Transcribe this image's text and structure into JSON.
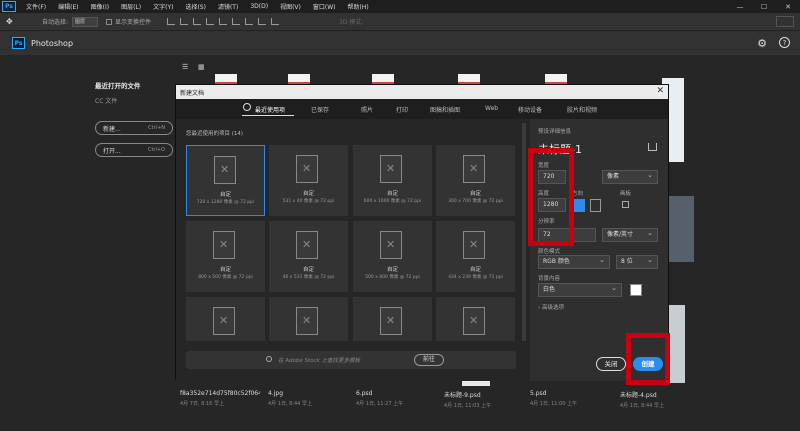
{
  "menubar": {
    "app_icon": "Ps",
    "items": [
      "文件(F)",
      "编辑(E)",
      "图像(I)",
      "图层(L)",
      "文字(Y)",
      "选择(S)",
      "滤镜(T)",
      "3D(D)",
      "视图(V)",
      "窗口(W)",
      "帮助(H)"
    ],
    "window_controls": [
      "—",
      "☐",
      "✕"
    ]
  },
  "options_bar": {
    "auto_select_label": "自动选择:",
    "auto_select_value": "图层",
    "show_transform_label": "显示变换控件",
    "mode_3d_label": "3D 模式:"
  },
  "home": {
    "logo": "Ps",
    "title": "Photoshop",
    "settings_icon": "⚙",
    "help_icon": "?"
  },
  "sidebar": {
    "recent_label": "最近打开的文件",
    "cc_label": "CC 文件",
    "new_button": {
      "label": "新建...",
      "shortcut": "Ctrl+N"
    },
    "open_button": {
      "label": "打开...",
      "shortcut": "Ctrl+O"
    }
  },
  "recent_files": [
    {
      "name": "f8a352e714d75f80c52f0648...",
      "date": "4月 7日, 8:16 早上"
    },
    {
      "name": "4.jpg",
      "date": "4月 1日, 8:44 早上"
    },
    {
      "name": "6.psd",
      "date": "4月 1日, 11:27 上午"
    },
    {
      "name": "未标题-9.psd",
      "date": "4月 1日, 11:03 上午"
    },
    {
      "name": "5.psd",
      "date": "4月 1日, 11:00 上午"
    },
    {
      "name": "未标题-4.psd",
      "date": "4月 1日, 8:44 早上"
    }
  ],
  "dialog": {
    "title": "新建文档",
    "close_icon": "✕",
    "tabs": [
      "最近使用项",
      "已保存",
      "照片",
      "打印",
      "图稿和插图",
      "Web",
      "移动设备",
      "胶片和视频"
    ],
    "active_tab": "最近使用项",
    "presets_heading": "您最近使用的项目 (14)",
    "presets": [
      {
        "name": "自定",
        "size": "720 x 1280 像素 @ 72 ppi"
      },
      {
        "name": "自定",
        "size": "531 x 40 像素 @ 72 ppi"
      },
      {
        "name": "自定",
        "size": "600 x 1000 像素 @ 72 ppi"
      },
      {
        "name": "自定",
        "size": "300 x 700 像素 @ 72 ppi"
      },
      {
        "name": "自定",
        "size": "800 x 500 像素 @ 72 ppi"
      },
      {
        "name": "自定",
        "size": "40 x 531 像素 @ 72 ppi"
      },
      {
        "name": "自定",
        "size": "500 x 800 像素 @ 72 ppi"
      },
      {
        "name": "自定",
        "size": "434 x 239 像素 @ 72 ppi"
      },
      {
        "name": "",
        "size": ""
      },
      {
        "name": "",
        "size": ""
      },
      {
        "name": "",
        "size": ""
      },
      {
        "name": "",
        "size": ""
      }
    ],
    "stock_placeholder": "在 Adobe Stock 上查找更多模板",
    "go_button": "前往",
    "details": {
      "section_label": "预设详细信息",
      "doc_name": "未标题-1",
      "width_label": "宽度",
      "width_value": "720",
      "unit_value": "像素",
      "height_label": "高度",
      "height_value": "1280",
      "orientation_label": "方向",
      "artboard_label": "画板",
      "resolution_label": "分辨率",
      "resolution_value": "72",
      "resolution_unit": "像素/英寸",
      "color_mode_label": "颜色模式",
      "color_mode_value": "RGB 颜色",
      "bit_depth_value": "8 位",
      "background_label": "背景内容",
      "background_value": "白色",
      "background_color": "#ffffff",
      "advanced_label": "› 高级选项",
      "close_button": "关闭",
      "create_button": "创建"
    }
  },
  "highlight_color": "#c8000f",
  "accent_color": "#2d8ceb"
}
